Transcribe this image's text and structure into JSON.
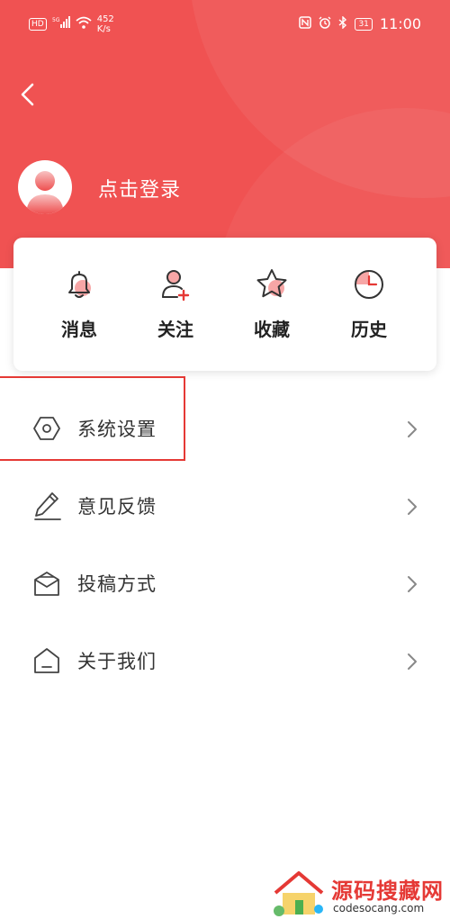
{
  "status_bar": {
    "hd": "HD",
    "net": "5G",
    "speed_value": "452",
    "speed_unit": "K/s",
    "battery": "31",
    "time": "11:00"
  },
  "profile": {
    "login_text": "点击登录"
  },
  "quick_actions": [
    {
      "label": "消息",
      "icon": "bell-icon"
    },
    {
      "label": "关注",
      "icon": "follow-user-icon"
    },
    {
      "label": "收藏",
      "icon": "star-icon"
    },
    {
      "label": "历史",
      "icon": "clock-icon"
    }
  ],
  "menu": [
    {
      "label": "系统设置",
      "icon": "settings-hexagon-icon"
    },
    {
      "label": "意见反馈",
      "icon": "pencil-icon"
    },
    {
      "label": "投稿方式",
      "icon": "mail-icon"
    },
    {
      "label": "关于我们",
      "icon": "house-icon"
    }
  ],
  "watermark": {
    "title": "源码搜藏网",
    "url": "codesocang.com"
  },
  "colors": {
    "header": "#f05252",
    "accent": "#e53935",
    "icon_accent": "#f36b6b",
    "text": "#333333"
  }
}
